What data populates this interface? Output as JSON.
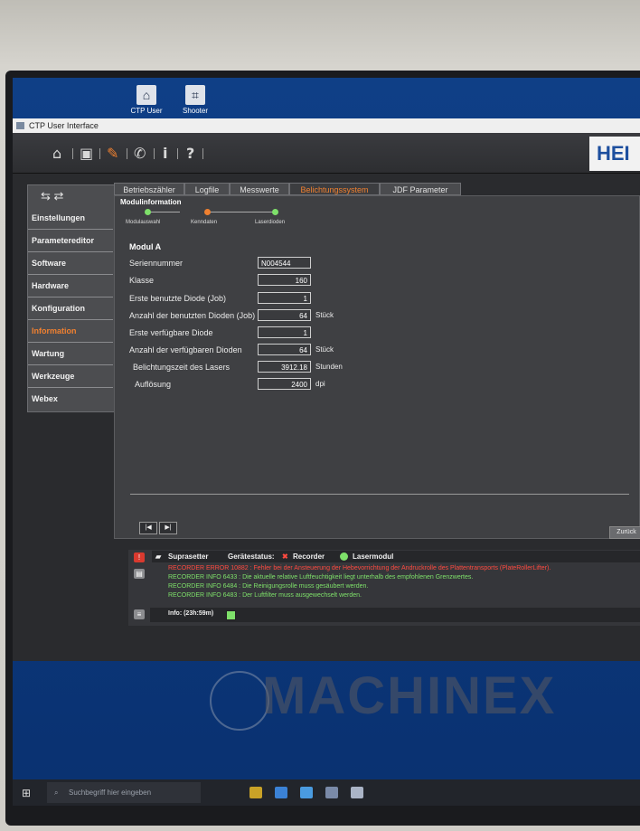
{
  "desktop": {
    "icons": [
      {
        "label": "CTP User",
        "glyph": "⌂",
        "icon": "ctp-user-icon"
      },
      {
        "label": "Shooter",
        "glyph": "⌗",
        "icon": "shooter-icon"
      }
    ]
  },
  "window": {
    "title": "CTP User Interface"
  },
  "toolbar": {
    "logo_text": "HEI"
  },
  "sidebar": {
    "items": [
      "Einstellungen",
      "Parametereditor",
      "Software",
      "Hardware",
      "Konfiguration",
      "Information",
      "Wartung",
      "Werkzeuge",
      "Webex"
    ],
    "active_index": 5
  },
  "tabs": {
    "items": [
      "Betriebszähler",
      "Logfile",
      "Messwerte",
      "Belichtungssystem",
      "JDF Parameter"
    ],
    "active_index": 3
  },
  "content": {
    "section_title": "Modulinformation",
    "steps": [
      "Modulauswahl",
      "Kenndaten",
      "Laserdioden"
    ],
    "module_title": "Modul A",
    "rows": [
      {
        "label": "Seriennummer",
        "value": "N004544",
        "unit": ""
      },
      {
        "label": "Klasse",
        "value": "160",
        "unit": ""
      },
      {
        "label": "Erste benutzte Diode (Job)",
        "value": "1",
        "unit": ""
      },
      {
        "label": "Anzahl der benutzten Dioden (Job)",
        "value": "64",
        "unit": "Stück"
      },
      {
        "label": "Erste verfügbare Diode",
        "value": "1",
        "unit": ""
      },
      {
        "label": "Anzahl der verfügbaren Dioden",
        "value": "64",
        "unit": "Stück"
      },
      {
        "label": "Belichtungszeit des Lasers",
        "value": "3912.18",
        "unit": "Stunden"
      },
      {
        "label": "Auflösung",
        "value": "2400",
        "unit": "dpi"
      }
    ],
    "back_label": "Zurück"
  },
  "status": {
    "device": "Suprasetter",
    "status_label": "Gerätestatus:",
    "recorder": "Recorder",
    "lasermodul": "Lasermodul",
    "messages": [
      {
        "text": "RECORDER ERROR 10882 : Fehler bei der Ansteuerung der Hebevorrichtung der Andruckrolle des Plattentransports (PlateRollerLifter).",
        "level": "error"
      },
      {
        "text": "RECORDER INFO 6433 : Die aktuelle relative Luftfeuchtigkeit liegt unterhalb des empfohlenen Grenzwertes.",
        "level": "info"
      },
      {
        "text": "RECORDER INFO 6484 : Die Reinigungsrolle muss gesäubert werden.",
        "level": "info"
      },
      {
        "text": "RECORDER INFO 6483 : Der Luftfilter muss ausgewechselt werden.",
        "level": "info"
      }
    ],
    "info_line": "Info: (23h:59m)"
  },
  "taskbar": {
    "search_placeholder": "Suchbegriff hier eingeben"
  },
  "watermark": {
    "text": "MACHINEX"
  },
  "colors": {
    "accent_orange": "#f08030",
    "error_red": "#ff4a40",
    "info_green": "#7ee06a",
    "desktop_blue": "#0f3f86"
  }
}
